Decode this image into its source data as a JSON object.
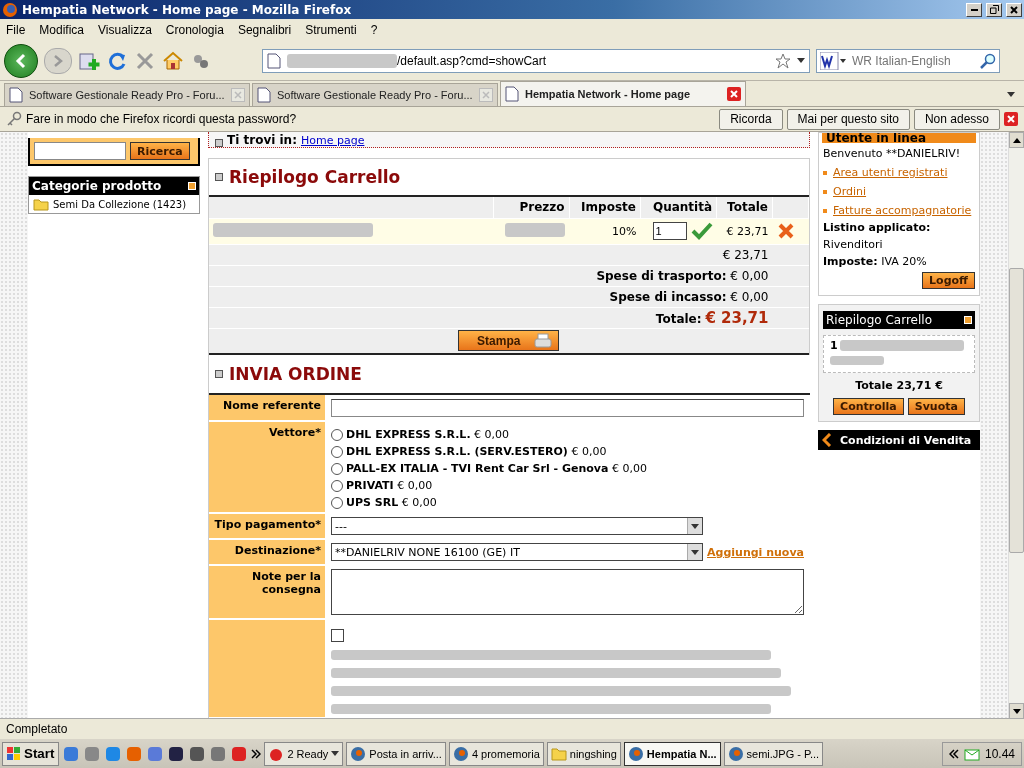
{
  "window": {
    "title": "Hempatia Network - Home page - Mozilla Firefox"
  },
  "menu": [
    "File",
    "Modifica",
    "Visualizza",
    "Cronologia",
    "Segnalibri",
    "Strumenti",
    "?"
  ],
  "address_bar": {
    "url": "/default.asp?cmd=showCart"
  },
  "search_bar": {
    "placeholder": "WR Italian-English"
  },
  "tabs": [
    {
      "label": "Software Gestionale Ready Pro - Foru...",
      "selected": false
    },
    {
      "label": "Software Gestionale Ready Pro - Foru...",
      "selected": false
    },
    {
      "label": "Hempatia Network - Home page",
      "selected": true
    }
  ],
  "password_bar": {
    "message": "Fare in modo che Firefox ricordi questa password?",
    "buttons": [
      "Ricorda",
      "Mai per questo sito",
      "Non adesso"
    ]
  },
  "sidebar": {
    "search_button": "Ricerca",
    "categories_title": "Categorie prodotto",
    "categories": [
      {
        "label": "Semi Da Collezione (1423)"
      }
    ]
  },
  "breadcrumb": {
    "label": "Ti trovi in:",
    "link": "Home page"
  },
  "cart": {
    "title": "Riepilogo Carrello",
    "columns": [
      "Prezzo",
      "Imposte",
      "Quantità",
      "Totale"
    ],
    "rows": [
      {
        "tax": "10%",
        "quantity": "1",
        "total": "€ 23,71"
      }
    ],
    "subtotal": "€ 23,71",
    "shipping_label": "Spese di trasporto:",
    "shipping": "€ 0,00",
    "collection_label": "Spese di incasso:",
    "collection": "€ 0,00",
    "total_label": "Totale:",
    "total": "€ 23,71",
    "print_button": "Stampa"
  },
  "order": {
    "title": "INVIA ORDINE",
    "name_label": "Nome referente",
    "carrier_label": "Vettore*",
    "carriers": [
      {
        "name": "DHL EXPRESS S.R.L.",
        "price": "€ 0,00",
        "selected": false
      },
      {
        "name": "DHL EXPRESS S.R.L. (SERV.ESTERO)",
        "price": "€ 0,00",
        "selected": false
      },
      {
        "name": "PALL-EX ITALIA - TVI Rent Car Srl - Genova",
        "price": "€ 0,00",
        "selected": false
      },
      {
        "name": "PRIVATI",
        "price": "€ 0,00",
        "selected": false
      },
      {
        "name": "UPS SRL",
        "price": "€ 0,00",
        "selected": false
      }
    ],
    "payment_label": "Tipo pagamento*",
    "payment_value": "---",
    "destination_label": "Destinazione*",
    "destination_value": "**DANIELRIV NONE 16100 (GE) IT",
    "add_link": "Aggiungi nuova",
    "notes_label": "Note per la consegna",
    "consent_checked": false
  },
  "user_box": {
    "title": "Utente in linea",
    "greeting": "Benvenuto **DANIELRIV!",
    "links": [
      "Area utenti registrati",
      "Ordini",
      "Fatture accompagnatorie"
    ],
    "price_list_label": "Listino applicato:",
    "price_list": "Rivenditori",
    "taxes_label": "Imposte:",
    "taxes": "IVA 20%",
    "logoff": "Logoff"
  },
  "mini_cart": {
    "title": "Riepilogo Carrello",
    "quantity": "1",
    "total": "Totale 23,71 €",
    "buttons": [
      "Controlla",
      "Svuota"
    ]
  },
  "conditions_link": "Condizioni di Vendita",
  "status_bar": "Completato",
  "taskbar": {
    "start": "Start",
    "items": [
      {
        "label": "2 Ready",
        "kind": "group",
        "selected": false
      },
      {
        "label": "Posta in arriv...",
        "kind": "window",
        "selected": false
      },
      {
        "label": "4 promemoria",
        "kind": "window",
        "selected": false
      },
      {
        "label": "ningshing",
        "kind": "folder",
        "selected": false
      },
      {
        "label": "Hempatia N...",
        "kind": "window",
        "selected": true
      },
      {
        "label": "semi.JPG - P...",
        "kind": "window",
        "selected": false
      }
    ],
    "clock": "10.44"
  }
}
